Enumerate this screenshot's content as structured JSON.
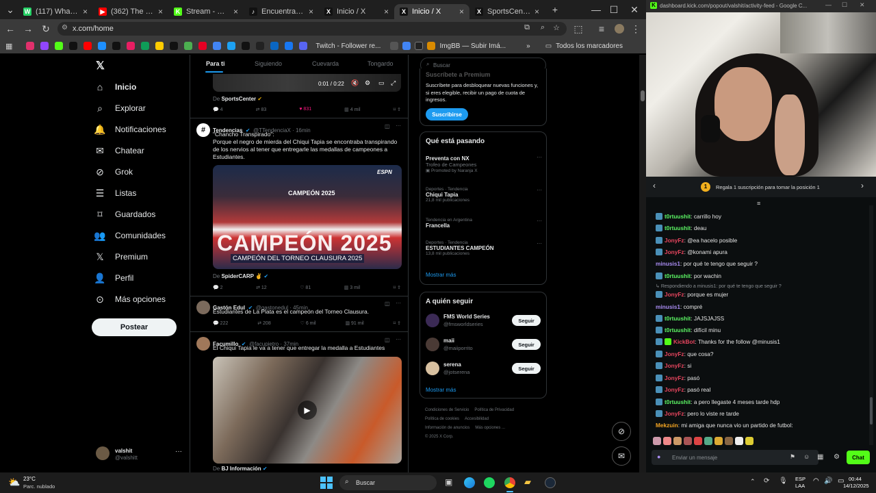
{
  "browser": {
    "tabs": [
      {
        "title": "(117) WhatsApp",
        "color": "#25d366",
        "icon": "W"
      },
      {
        "title": "(362) The Party Ba",
        "color": "#ff0000",
        "icon": "▶"
      },
      {
        "title": "Stream - Kick Da",
        "color": "#53fc18",
        "icon": "K"
      },
      {
        "title": "Encuentra 'estud",
        "color": "#111111",
        "icon": "♪"
      },
      {
        "title": "Inicio / X",
        "color": "#111111",
        "icon": "X"
      },
      {
        "title": "Inicio / X",
        "color": "#111111",
        "icon": "X"
      },
      {
        "title": "SportsCenter en",
        "color": "#111111",
        "icon": "X"
      }
    ],
    "url": "x.com/home",
    "bookmarks": [
      "Twitch - Follower re...",
      "ImgBB — Subir Imá...",
      "Todos los marcadores"
    ]
  },
  "xnav": {
    "items": [
      "Inicio",
      "Explorar",
      "Notificaciones",
      "Chatear",
      "Grok",
      "Listas",
      "Guardados",
      "Comunidades",
      "Premium",
      "Perfil",
      "Más opciones"
    ],
    "post_label": "Postear",
    "user_name": "valshit",
    "user_handle": "@valshitt"
  },
  "feed": {
    "tabs": [
      "Para ti",
      "Siguiendo",
      "Cuevarda",
      "Tongardo"
    ],
    "video_time": "0:01 / 0:22",
    "tweet0": {
      "via": "SportsCenter",
      "replies": "4",
      "reposts": "83",
      "likes": "831",
      "views": "4 mil"
    },
    "tweet1": {
      "name": "Tendencias",
      "handle": "@TTendenciaX · 16min",
      "text1": "\"Chancho Transpirado\":",
      "text2": "Porque el negro de mierda del Chiqui Tapia se encontraba transpirando de los nervios al tener que entregarle las medallas de campeones a Estudiantes.",
      "img_overlay": "CAMPEÓN 2025",
      "img_caption": "CAMPEÓN DEL TORNEO CLAUSURA 2025",
      "via": "SpiderCARP",
      "replies": "2",
      "reposts": "12",
      "likes": "81",
      "views": "3 mil"
    },
    "tweet2": {
      "name": "Gastón Edul",
      "handle": "@gastonedul · 45min",
      "text": "Estudiantes de La Plata es el campeón del Torneo Clausura.",
      "replies": "222",
      "reposts": "208",
      "likes": "6 mil",
      "views": "91 mil"
    },
    "tweet3": {
      "name": "Facumillo",
      "handle": "@facupietro · 37min",
      "text": "El Chiqui Tapia le va a tener que entregar la medalla a Estudiantes",
      "via": "BJ Información"
    }
  },
  "sidebar": {
    "search_placeholder": "Buscar",
    "premium_title": "Suscríbete a Premium",
    "premium_text": "Suscríbete para desbloquear nuevas funciones y, si eres elegible, recibir un pago de cuota de ingresos.",
    "premium_button": "Suscribirse",
    "trends_title": "Qué está pasando",
    "trends": [
      {
        "meta": "",
        "name": "Preventa con NX",
        "sub": "Trofeo de Campeones",
        "promo": "Promoted by Naranja X"
      },
      {
        "meta": "Deportes · Tendencia",
        "name": "Chiqui Tapia",
        "sub": "21,8 mil publicaciones",
        "promo": ""
      },
      {
        "meta": "Tendencia en Argentina",
        "name": "Francella",
        "sub": "",
        "promo": ""
      },
      {
        "meta": "Deportes · Tendencia",
        "name": "ESTUDIANTES CAMPEÓN",
        "sub": "13,8 mil publicaciones",
        "promo": ""
      }
    ],
    "show_more": "Mostrar más",
    "follow_title": "A quién seguir",
    "follow": [
      {
        "name": "FMS World Series",
        "handle": "@fmsworldseries",
        "button": "Seguir"
      },
      {
        "name": "maii",
        "handle": "@maiiporrito",
        "button": "Seguir"
      },
      {
        "name": "serena",
        "handle": "@jotserena",
        "button": "Seguir"
      }
    ],
    "footer": [
      "Condiciones de Servicio",
      "Política de Privacidad",
      "Política de cookies",
      "Accesibilidad",
      "Información de anuncios",
      "Más opciones ...",
      "© 2025 X Corp."
    ]
  },
  "kick": {
    "url": "dashboard.kick.com/popout/valshit/activity-feed - Google C...",
    "sub_banner": "Regala 1 suscripción para tomar la posición 1",
    "reply_note": "Respondiendo a minusis1: por qué te tengo que seguir ?",
    "messages": [
      {
        "user": "t0rtuushit",
        "color": "#5cf564",
        "text": "carrillo hoy"
      },
      {
        "user": "t0rtuushit",
        "color": "#5cf564",
        "text": "deau"
      },
      {
        "user": "JonyFz",
        "color": "#e6455e",
        "text": "@ea hacelo posible"
      },
      {
        "user": "JonyFz",
        "color": "#e6455e",
        "text": "@konami apura"
      },
      {
        "user": "minusis1",
        "color": "#a98cf2",
        "text": "por qué te tengo que seguir ?"
      },
      {
        "user": "t0rtuushit",
        "color": "#5cf564",
        "text": "por wachin"
      },
      {
        "user": "JonyFz",
        "color": "#e6455e",
        "text": "porque es mujer"
      },
      {
        "user": "minusis1",
        "color": "#a98cf2",
        "text": "compré"
      },
      {
        "user": "t0rtuushit",
        "color": "#5cf564",
        "text": "JAJSJAJSS"
      },
      {
        "user": "t0rtuushit",
        "color": "#5cf564",
        "text": "difícil minu"
      },
      {
        "user": "KickBot",
        "color": "#e6455e",
        "text": "Thanks for the follow @minusis1"
      },
      {
        "user": "JonyFz",
        "color": "#e6455e",
        "text": "que cosa?"
      },
      {
        "user": "JonyFz",
        "color": "#e6455e",
        "text": "si"
      },
      {
        "user": "JonyFz",
        "color": "#e6455e",
        "text": "pasó"
      },
      {
        "user": "JonyFz",
        "color": "#e6455e",
        "text": "pasó real"
      },
      {
        "user": "t0rtuushit",
        "color": "#5cf564",
        "text": "a pero llegaste 4 meses tarde hdp"
      },
      {
        "user": "JonyFz",
        "color": "#e6455e",
        "text": "pero lo viste re tarde"
      },
      {
        "user": "Mekzuin",
        "color": "#f5a623",
        "text": "mi amiga que nunca vio un partido de futbol:"
      }
    ],
    "input_placeholder": "Enviar un mensaje",
    "chat_button": "Chat"
  },
  "taskbar": {
    "weather_temp": "23°C",
    "weather_desc": "Parc. nublado",
    "search": "Buscar",
    "lang1": "ESP",
    "lang2": "LAA",
    "time": "00:44",
    "date": "14/12/2025"
  }
}
